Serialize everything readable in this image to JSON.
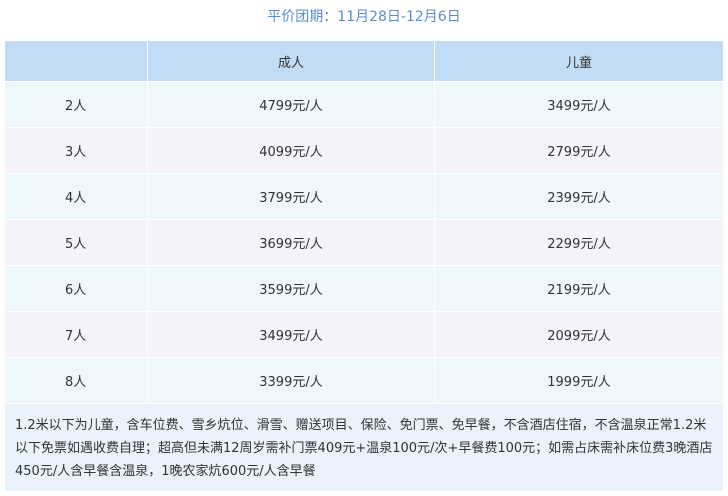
{
  "title": "平价团期：11月28日-12月6日",
  "table": {
    "headers": [
      "",
      "成人",
      "儿童"
    ],
    "rows": [
      {
        "count": "2人",
        "adult": "4799元/人",
        "child": "3499元/人"
      },
      {
        "count": "3人",
        "adult": "4099元/人",
        "child": "2799元/人"
      },
      {
        "count": "4人",
        "adult": "3799元/人",
        "child": "2399元/人"
      },
      {
        "count": "5人",
        "adult": "3699元/人",
        "child": "2299元/人"
      },
      {
        "count": "6人",
        "adult": "3599元/人",
        "child": "2199元/人"
      },
      {
        "count": "7人",
        "adult": "3499元/人",
        "child": "2099元/人"
      },
      {
        "count": "8人",
        "adult": "3399元/人",
        "child": "1999元/人"
      }
    ],
    "note": "1.2米以下为儿童，含车位费、雪乡炕位、滑雪、赠送项目、保险、免门票、免早餐，不含酒店住宿，不含温泉正常1.2米以下免票如遇收费自理；超高但未满12周岁需补门票409元+温泉100元/次+早餐费100元；如需占床需补床位费3晚酒店450元/人含早餐含温泉，1晚农家炕600元/人含早餐"
  },
  "colors": {
    "title": "#5b8ec9",
    "header_bg": "#c3dcf5",
    "row_odd_bg": "#edf7fc",
    "row_even_bg": "#f4f3fb",
    "note_bg": "#eaf2fb"
  }
}
